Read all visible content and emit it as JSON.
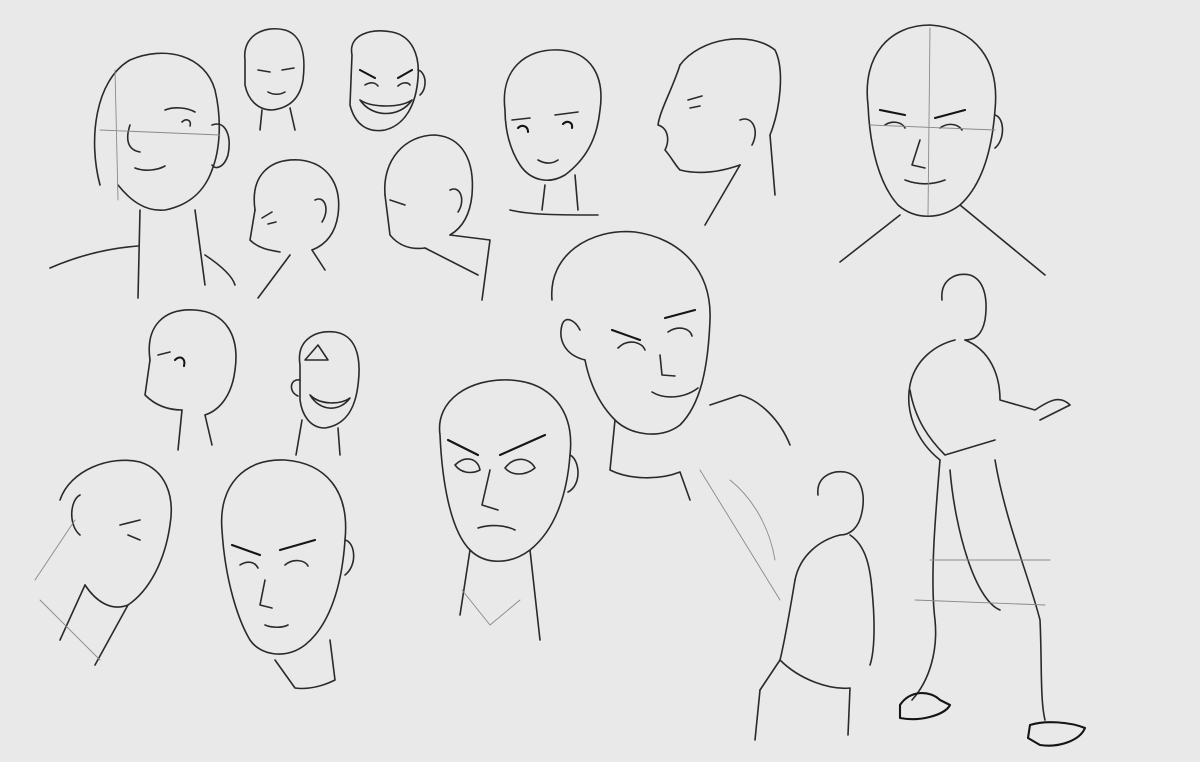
{
  "canvas": {
    "background_color": "#e9e9e9",
    "stroke_color": "#2a2a2a",
    "construction_color": "#8a8a8a"
  },
  "sketches": [
    {
      "name": "head-three-quarter-up-left",
      "kind": "head"
    },
    {
      "name": "head-small-front-top",
      "kind": "head"
    },
    {
      "name": "head-grinning-cartoon",
      "kind": "head"
    },
    {
      "name": "head-side-bald",
      "kind": "head"
    },
    {
      "name": "head-side-down",
      "kind": "head"
    },
    {
      "name": "head-anime-three-quarter",
      "kind": "head"
    },
    {
      "name": "head-profile-right",
      "kind": "head"
    },
    {
      "name": "head-bald-front-stern",
      "kind": "head"
    },
    {
      "name": "head-turned-left",
      "kind": "head"
    },
    {
      "name": "head-smiling-small",
      "kind": "head"
    },
    {
      "name": "head-tilted-down-left",
      "kind": "head"
    },
    {
      "name": "head-bald-front-glare",
      "kind": "head"
    },
    {
      "name": "head-front-shaded-eyes",
      "kind": "head"
    },
    {
      "name": "head-bald-tilted-smirk",
      "kind": "head"
    },
    {
      "name": "figure-walking-jeans",
      "kind": "figure"
    },
    {
      "name": "figure-small-standing",
      "kind": "figure"
    }
  ]
}
